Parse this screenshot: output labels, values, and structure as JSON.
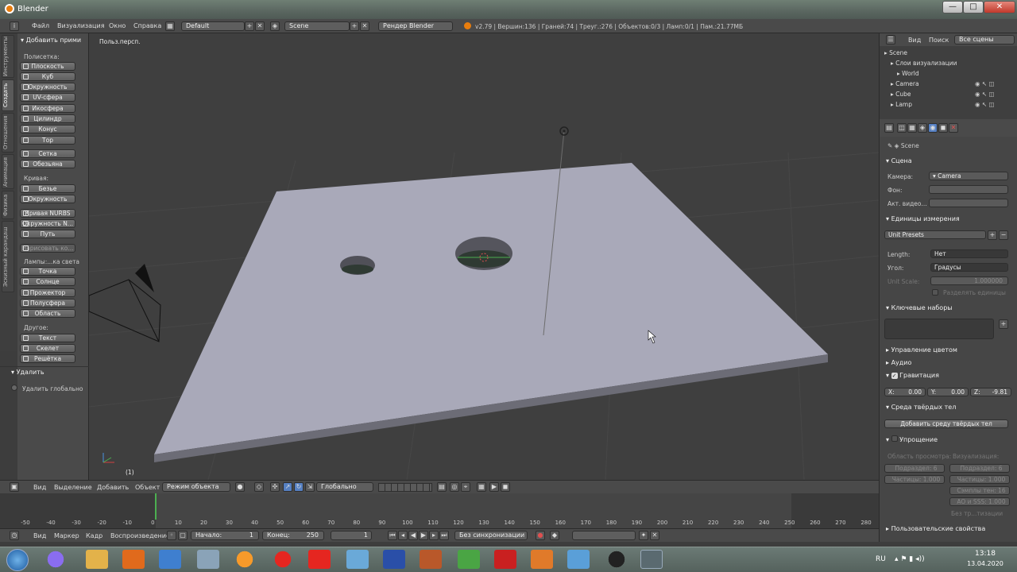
{
  "window": {
    "title": "Blender",
    "min": "—",
    "max": "□",
    "close": "✕"
  },
  "topbar": {
    "menus": [
      "Файл",
      "Визуализация",
      "Окно",
      "Справка"
    ],
    "layout": "Default",
    "scene": "Scene",
    "engine": "Рендер Blender",
    "stats": "v2.79 | Вершин:136 | Граней:74 | Треуг.:276 | Объектов:0/3 | Ламп:0/1 | Пам.:21.77МБ"
  },
  "toolshelf": {
    "tabs": [
      "Инструменты",
      "Создать",
      "Отношения",
      "Анимация",
      "Физика",
      "Эскизный карандаш"
    ],
    "header": "Добавить прими",
    "mesh_label": "Полисетка:",
    "mesh": [
      "Плоскость",
      "Куб",
      "Окружность",
      "UV-сфера",
      "Икосфера",
      "Цилиндр",
      "Конус",
      "Тор",
      "Сетка",
      "Обезьяна"
    ],
    "curve_label": "Кривая:",
    "curve": [
      "Безье",
      "Окружность",
      "Кривая NURBS",
      "Окружность N...",
      "Путь",
      "Нарисовать ко..."
    ],
    "lamp_label": "Лампы:...ка света",
    "lamp": [
      "Точка",
      "Солнце",
      "Прожектор",
      "Полусфера",
      "Область"
    ],
    "other_label": "Другое:",
    "other": [
      "Текст",
      "Скелет",
      "Решётка"
    ],
    "delete_header": "Удалить",
    "delete_global": "Удалить глобально"
  },
  "viewport": {
    "label": "Польз.персп.",
    "frame": "(1)"
  },
  "vpbar": {
    "items": [
      "Вид",
      "Выделение",
      "Добавить",
      "Объект"
    ],
    "mode": "Режим объекта",
    "orientation": "Глобально"
  },
  "timeline": {
    "ticks": [
      "-50",
      "-40",
      "-30",
      "-20",
      "-10",
      "0",
      "10",
      "20",
      "30",
      "40",
      "50",
      "60",
      "70",
      "80",
      "90",
      "100",
      "110",
      "120",
      "130",
      "140",
      "150",
      "160",
      "170",
      "180",
      "190",
      "200",
      "210",
      "220",
      "230",
      "240",
      "250",
      "260",
      "270",
      "280"
    ]
  },
  "tlbar": {
    "items": [
      "Вид",
      "Маркер",
      "Кадр",
      "Воспроизведение"
    ],
    "start_label": "Начало:",
    "start": "1",
    "end_label": "Конец:",
    "end": "250",
    "current": "1",
    "sync": "Без синхронизации"
  },
  "outliner": {
    "menus": [
      "Вид",
      "Поиск"
    ],
    "filter": "Все сцены",
    "items": [
      "Scene",
      "Слои визуализации",
      "World",
      "Camera",
      "Cube",
      "Lamp"
    ]
  },
  "props": {
    "context": "Scene",
    "scene_header": "Сцена",
    "camera_label": "Камера:",
    "camera": "Camera",
    "bg_label": "Фон:",
    "active_clip_label": "Акт. видео...",
    "units_header": "Единицы измерения",
    "unit_presets": "Unit Presets",
    "length_label": "Length:",
    "length": "Нет",
    "angle_label": "Угол:",
    "angle": "Градусы",
    "unit_scale_label": "Unit Scale:",
    "unit_scale": "1.000000",
    "separate_units": "Разделять единицы",
    "keying_header": "Ключевые наборы",
    "color_mgmt": "Управление цветом",
    "audio": "Аудио",
    "gravity_header": "Гравитация",
    "gx": "X:",
    "gx_val": "0.00",
    "gy": "Y:",
    "gy_val": "0.00",
    "gz": "Z:",
    "gz_val": "-9.81",
    "rigid_header": "Среда твёрдых тел",
    "rigid_add": "Добавить среду твёрдых тел",
    "simplify_header": "Упрощение",
    "viewport_label": "Область просмотра:",
    "render_label": "Визуализация:",
    "subdiv_vp": "Подраздел: 6",
    "subdiv_r": "Подраздел: 6",
    "part_vp": "Частицы: 1.000",
    "part_r": "Частицы: 1.000",
    "samples": "Сэмплы тен: 16",
    "ao": "AO и SSS: 1.000",
    "no_tex": "Без тр...тизации",
    "custom_props": "Пользовательские свойства"
  },
  "taskbar": {
    "lang": "RU",
    "time": "13:18",
    "date": "13.04.2020"
  },
  "colors": {
    "accent": "#5680c2",
    "plane": "#a8a8b8",
    "header": "#4a4a4a",
    "viewport": "#3f3f3f"
  }
}
